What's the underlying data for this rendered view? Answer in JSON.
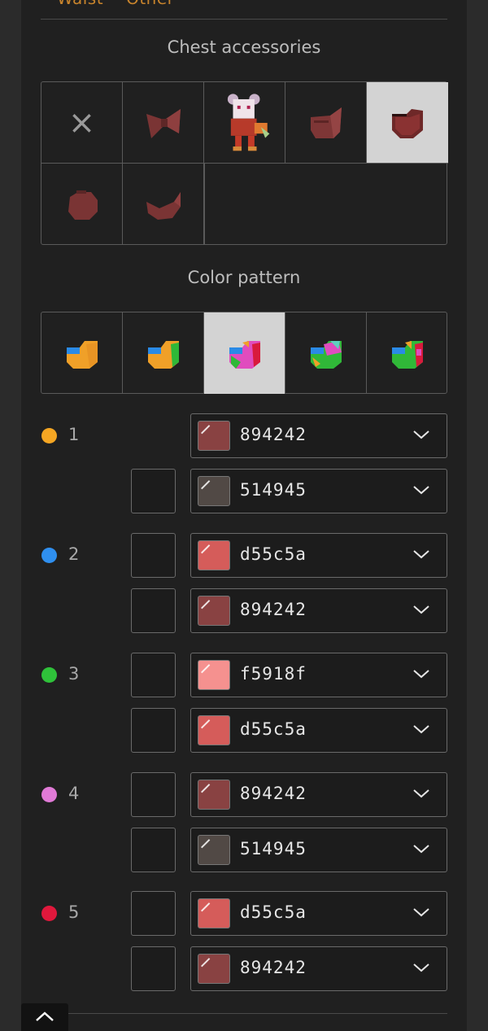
{
  "top_tabs": [
    "Waist",
    "Other"
  ],
  "chest_section": {
    "title": "Chest accessories",
    "items": [
      {
        "icon": "none-icon",
        "label": "×"
      },
      {
        "icon": "bow-accessory-icon"
      },
      {
        "icon": "character-preview-icon"
      },
      {
        "icon": "heart-bag-accessory-icon"
      },
      {
        "icon": "heart-pouch-accessory-icon",
        "selected": true
      },
      {
        "icon": "round-accessory-icon"
      },
      {
        "icon": "tilted-heart-accessory-icon"
      }
    ]
  },
  "pattern_section": {
    "title": "Color pattern",
    "items": [
      {
        "icon": "pattern-1-icon"
      },
      {
        "icon": "pattern-2-icon"
      },
      {
        "icon": "pattern-3-icon",
        "selected": true
      },
      {
        "icon": "pattern-4-icon"
      },
      {
        "icon": "pattern-5-icon"
      }
    ]
  },
  "color_rows": [
    {
      "num": "1",
      "dot_color": "#f5a623",
      "primary": {
        "hex": "894242",
        "swatch": "#894242"
      },
      "secondary": {
        "hex": "514945",
        "swatch": "#514945"
      }
    },
    {
      "num": "2",
      "dot_color": "#2f8fef",
      "primary": {
        "hex": "d55c5a",
        "swatch": "#d55c5a"
      },
      "secondary": {
        "hex": "894242",
        "swatch": "#894242"
      }
    },
    {
      "num": "3",
      "dot_color": "#2fc23a",
      "primary": {
        "hex": "f5918f",
        "swatch": "#f5918f"
      },
      "secondary": {
        "hex": "d55c5a",
        "swatch": "#d55c5a"
      }
    },
    {
      "num": "4",
      "dot_color": "#e07ad6",
      "primary": {
        "hex": "894242",
        "swatch": "#894242"
      },
      "secondary": {
        "hex": "514945",
        "swatch": "#514945"
      }
    },
    {
      "num": "5",
      "dot_color": "#e0183c",
      "primary": {
        "hex": "d55c5a",
        "swatch": "#d55c5a"
      },
      "secondary": {
        "hex": "894242",
        "swatch": "#894242"
      }
    }
  ],
  "scroll_up_icon": "chevron-up-icon"
}
